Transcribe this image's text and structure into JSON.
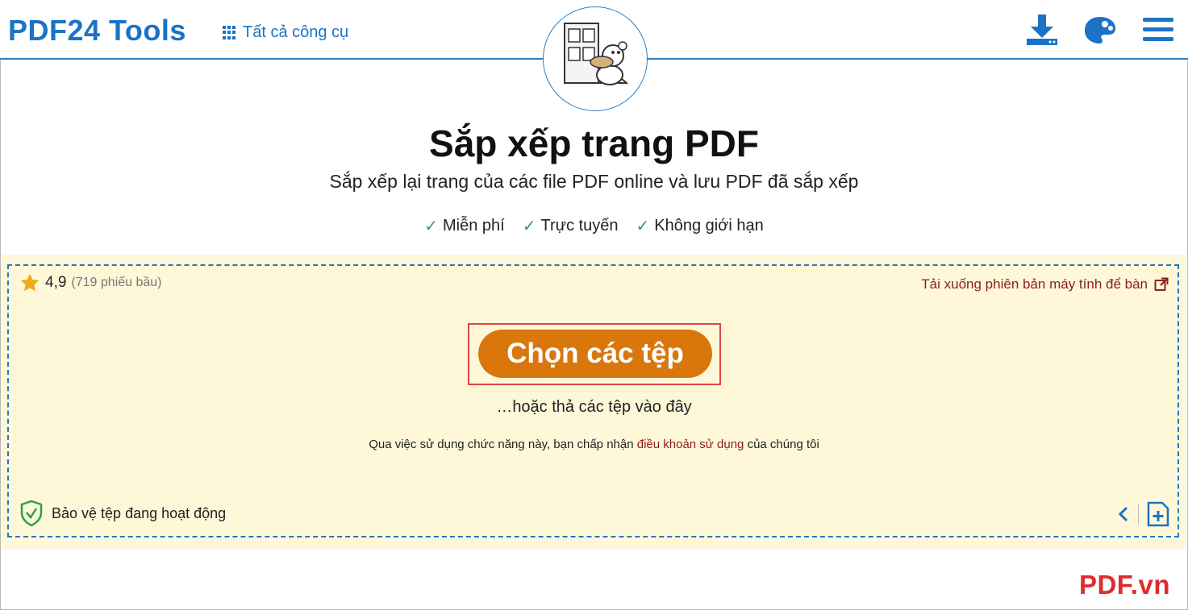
{
  "header": {
    "logo": "PDF24 Tools",
    "all_tools_label": "Tất cả công cụ",
    "icons": [
      "download-icon",
      "palette-icon",
      "menu-icon"
    ]
  },
  "main": {
    "title": "Sắp xếp trang PDF",
    "subtitle": "Sắp xếp lại trang của các file PDF online và lưu PDF đã sắp xếp",
    "features": [
      "Miễn phí",
      "Trực tuyến",
      "Không giới hạn"
    ]
  },
  "panel": {
    "rating_value": "4,9",
    "rating_votes": "(719 phiếu bầu)",
    "desktop_link": "Tải xuống phiên bản máy tính để bàn",
    "choose_button": "Chọn các tệp",
    "drop_hint": "…hoặc thả các tệp vào đây",
    "terms_prefix": "Qua việc sử dụng chức năng này, bạn chấp nhận",
    "terms_link": "điều khoản sử dụng",
    "terms_suffix": "của chúng tôi",
    "protection_label": "Bảo vệ tệp đang hoạt động"
  },
  "watermark": "PDF.vn",
  "colors": {
    "brand_blue": "#1a73c7",
    "button_orange": "#d9770d",
    "panel_bg": "#fef8d9",
    "highlight_red": "#e04444",
    "link_dark_red": "#8b1e1e",
    "check_green": "#2aa144",
    "star_gold": "#f0a81c"
  }
}
